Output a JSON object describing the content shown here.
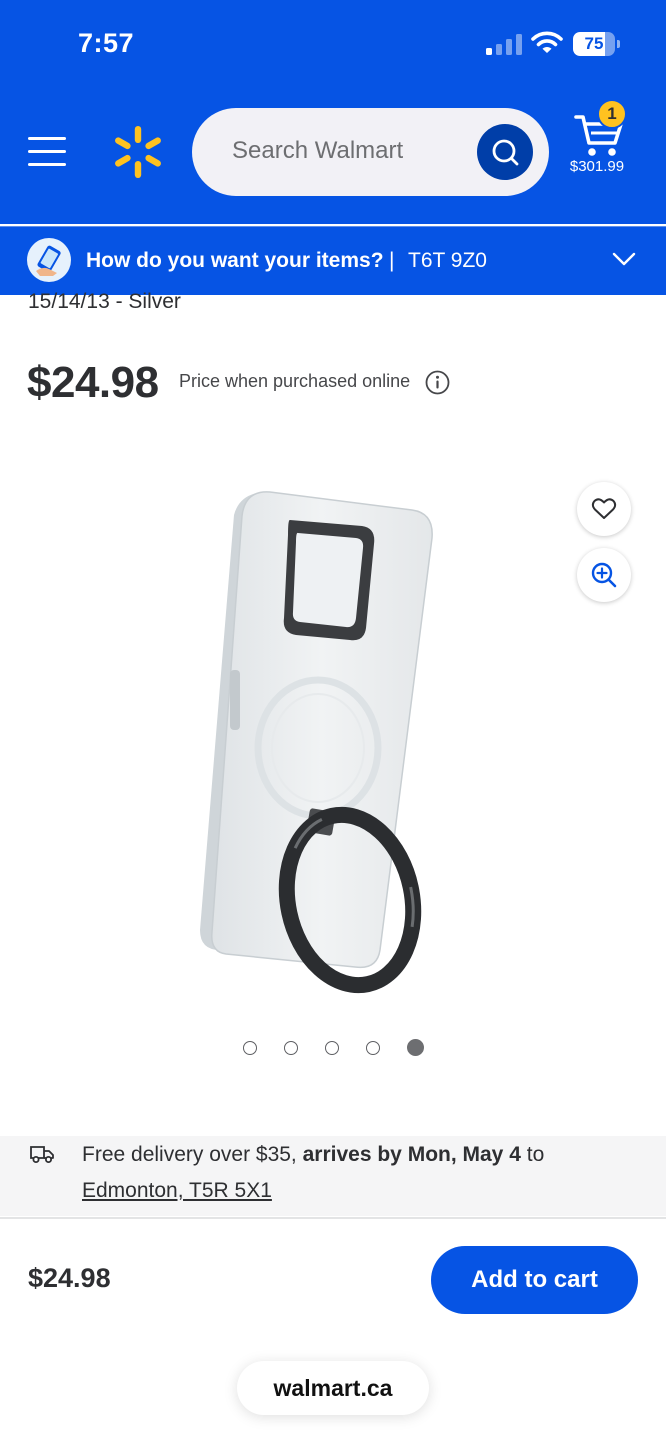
{
  "status_bar": {
    "time": "7:57",
    "battery": "75",
    "battery_level": 0.75
  },
  "header": {
    "search_placeholder": "Search Walmart",
    "cart_count": "1",
    "cart_total": "$301.99",
    "icons": [
      "menu-icon",
      "walmart-spark-logo",
      "search-icon",
      "cart-icon"
    ],
    "colors": {
      "brand_blue": "#0654e4",
      "spark_yellow": "#ffc220",
      "search_button": "#003ea8"
    }
  },
  "fulfillment": {
    "question": "How do you want your items?",
    "separator": "|",
    "postal_code": "T6T 9Z0"
  },
  "product": {
    "title_fragment": "15/14/13 - Silver",
    "price": "$24.98",
    "price_note": "Price when purchased online",
    "image_alt": "Clear phone case with magnetic ring stand",
    "gallery": {
      "count": 5,
      "active_index": 4
    }
  },
  "delivery": {
    "text_prefix": "Free delivery over $35,",
    "text_bold": "arrives by Mon, May 4",
    "text_suffix": "to",
    "location": "Edmonton, T5R 5X1"
  },
  "sticky_bar": {
    "price": "$24.98",
    "add_to_cart_label": "Add to cart"
  },
  "browser": {
    "url": "walmart.ca"
  }
}
